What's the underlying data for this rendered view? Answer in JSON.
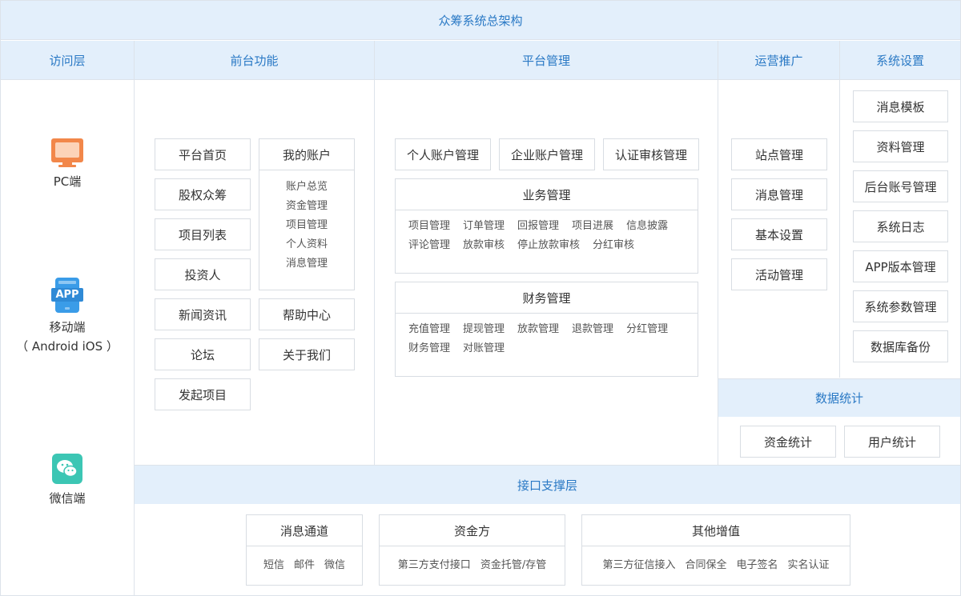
{
  "title": "众筹系统总架构",
  "headers": {
    "access": "访问层",
    "frontend": "前台功能",
    "platform": "平台管理",
    "ops": "运营推广",
    "settings": "系统设置",
    "stats": "数据统计",
    "interface": "接口支撑层"
  },
  "access": {
    "pc": "PC端",
    "app_badge": "APP",
    "mobile": "移动端",
    "mobile_sub": "（ Android  iOS ）",
    "wechat": "微信端"
  },
  "frontend": {
    "left": [
      "平台首页",
      "股权众筹",
      "项目列表",
      "投资人",
      "新闻资讯",
      "论坛",
      "发起项目"
    ],
    "account": {
      "title": "我的账户",
      "items": [
        "账户总览",
        "资金管理",
        "项目管理",
        "个人资料",
        "消息管理"
      ]
    },
    "right": [
      "帮助中心",
      "关于我们"
    ]
  },
  "platform": {
    "top": [
      "个人账户管理",
      "企业账户管理",
      "认证审核管理"
    ],
    "business": {
      "title": "业务管理",
      "items": [
        "项目管理",
        "订单管理",
        "回报管理",
        "项目进展",
        "信息披露",
        "评论管理",
        "放款审核",
        "停止放款审核",
        "分红审核"
      ]
    },
    "finance": {
      "title": "财务管理",
      "items": [
        "充值管理",
        "提现管理",
        "放款管理",
        "退款管理",
        "分红管理",
        "财务管理",
        "对账管理"
      ]
    }
  },
  "ops": [
    "站点管理",
    "消息管理",
    "基本设置",
    "活动管理"
  ],
  "settings": [
    "消息模板",
    "资料管理",
    "后台账号管理",
    "系统日志",
    "APP版本管理",
    "系统参数管理",
    "数据库备份"
  ],
  "stats": [
    "资金统计",
    "用户统计"
  ],
  "interface": {
    "message": {
      "title": "消息通道",
      "items": [
        "短信",
        "邮件",
        "微信"
      ]
    },
    "funds": {
      "title": "资金方",
      "items": [
        "第三方支付接口",
        "资金托管/存管"
      ]
    },
    "other": {
      "title": "其他增值",
      "items": [
        "第三方征信接入",
        "合同保全",
        "电子签名",
        "实名认证"
      ]
    }
  },
  "colors": {
    "header_bg": "#e3effb",
    "header_text": "#2a79c5",
    "pc_icon": "#f2874a",
    "app_icon": "#3a9ce8",
    "wechat_icon": "#3cc6b4"
  }
}
